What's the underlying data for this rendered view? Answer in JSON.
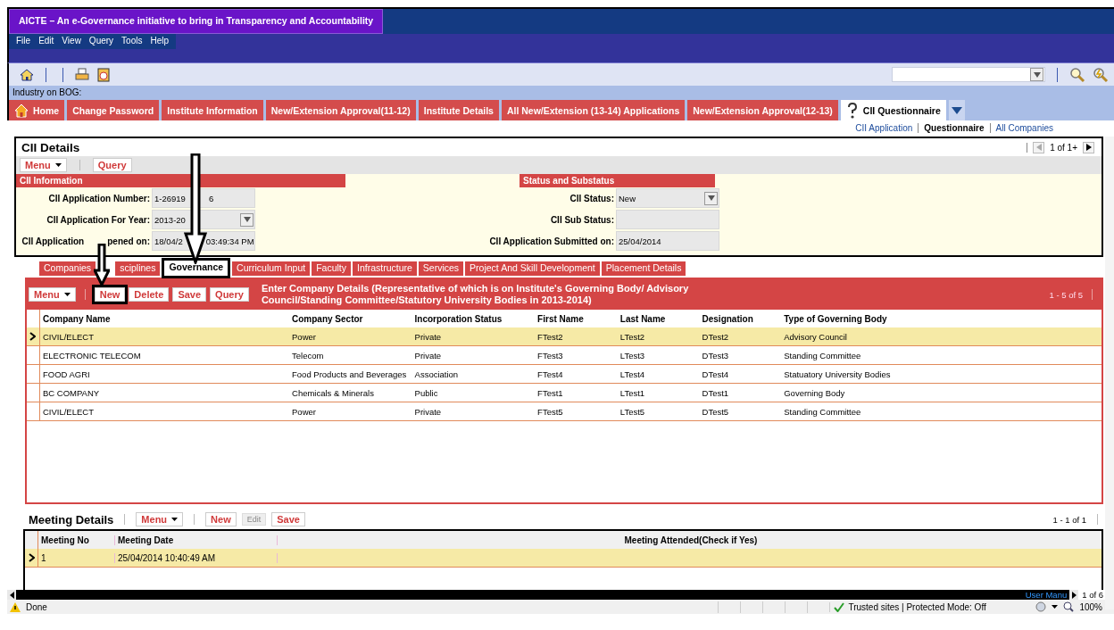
{
  "window": {
    "title": "AICTE – An e-Governance initiative to bring in Transparency and Accountability"
  },
  "menu": [
    "File",
    "Edit",
    "View",
    "Query",
    "Tools",
    "Help"
  ],
  "breadcrumb": "Industry on BOG:",
  "screen_tabs": [
    {
      "label": "Home",
      "selected": false,
      "kind": "home"
    },
    {
      "label": "Change Password",
      "selected": false,
      "kind": "plain"
    },
    {
      "label": "Institute Information",
      "selected": false,
      "kind": "plain"
    },
    {
      "label": "New/Extension Approval(11-12)",
      "selected": false,
      "kind": "plain"
    },
    {
      "label": "Institute Details",
      "selected": false,
      "kind": "plain"
    },
    {
      "label": "All New/Extension (13-14) Applications",
      "selected": false,
      "kind": "plain"
    },
    {
      "label": "New/Extension Approval(12-13)",
      "selected": false,
      "kind": "plain"
    },
    {
      "label": "CII Questionnaire",
      "selected": true,
      "kind": "icon"
    }
  ],
  "view_links": [
    {
      "label": "CII Application",
      "selected": false
    },
    {
      "label": "Questionnaire",
      "selected": true
    },
    {
      "label": "All Companies",
      "selected": false
    }
  ],
  "details": {
    "title": "CII Details",
    "pager": "1 of 1+",
    "buttons": [
      "Menu",
      "Query"
    ],
    "left_header": "CII Information",
    "right_header": "Status and Substatus",
    "left_fields": [
      {
        "label": "CII Application Number:",
        "value": "1-26919",
        "value_end": "6",
        "kind": "text"
      },
      {
        "label": "CII Application For Year:",
        "value": "2013-20",
        "kind": "dropdown"
      },
      {
        "label": "CII Application",
        "label_end": "pened on:",
        "value": "18/04/2",
        "value_end": "03:49:34 PM",
        "kind": "text"
      }
    ],
    "right_fields": [
      {
        "label": "CII Status:",
        "value": "New",
        "kind": "dropdown"
      },
      {
        "label": "CII Sub Status:",
        "kind": "text"
      },
      {
        "label": "CII Application Submitted on:",
        "value": "25/04/2014",
        "kind": "text"
      }
    ]
  },
  "view_tabs": [
    {
      "label": "Companies",
      "selected": false
    },
    {
      "label": "sciplines",
      "selected": false
    },
    {
      "label": "Governance",
      "selected": true
    },
    {
      "label": "Curriculum Input",
      "selected": false
    },
    {
      "label": "Faculty",
      "selected": false
    },
    {
      "label": "Infrastructure",
      "selected": false
    },
    {
      "label": "Services",
      "selected": false
    },
    {
      "label": "Project And Skill Development",
      "selected": false
    },
    {
      "label": "Placement Details",
      "selected": false
    }
  ],
  "companies": {
    "buttons": [
      "Menu",
      "New",
      "Delete",
      "Save",
      "Query"
    ],
    "title": "Enter Company Details (Representative of which is on Institute's Governing Body/ Advisory Council/Standing Committee/Statutory University Bodies in 2013-2014)",
    "pager": "1 - 5 of 5",
    "columns": [
      "Company Name",
      "Company Sector",
      "Incorporation Status",
      "First Name",
      "Last Name",
      "Designation",
      "Type of Governing Body"
    ],
    "rows": [
      {
        "selected": true,
        "cells": [
          "CIVIL/ELECT",
          "Power",
          "Private",
          "FTest2",
          "LTest2",
          "DTest2",
          "Advisory Council"
        ]
      },
      {
        "selected": false,
        "cells": [
          "ELECTRONIC TELECOM",
          "Telecom",
          "Private",
          "FTest3",
          "LTest3",
          "DTest3",
          "Standing Committee"
        ]
      },
      {
        "selected": false,
        "cells": [
          "FOOD AGRI",
          "Food Products and Beverages",
          "Association",
          "FTest4",
          "LTest4",
          "DTest4",
          "Statuatory University Bodies"
        ]
      },
      {
        "selected": false,
        "cells": [
          "BC COMPANY",
          "Chemicals & Minerals",
          "Public",
          "FTest1",
          "LTest1",
          "DTest1",
          "Governing Body"
        ]
      },
      {
        "selected": false,
        "cells": [
          "CIVIL/ELECT",
          "Power",
          "Private",
          "FTest5",
          "LTest5",
          "DTest5",
          "Standing Committee"
        ]
      }
    ]
  },
  "meetings": {
    "title": "Meeting Details",
    "buttons": [
      {
        "label": "Menu",
        "disabled": false
      },
      {
        "label": "New",
        "disabled": false
      },
      {
        "label": "Edit",
        "disabled": true
      },
      {
        "label": "Save",
        "disabled": false
      }
    ],
    "pager": "1 - 1 of 1",
    "columns": [
      "Meeting No",
      "Meeting Date",
      "Meeting Attended(Check if Yes)"
    ],
    "rows": [
      {
        "selected": true,
        "cells": [
          "1",
          "25/04/2014 10:40:49 AM"
        ]
      }
    ]
  },
  "footer": {
    "link": "User Manu",
    "pager": "1 of 6"
  },
  "status_bar": {
    "text": "Done",
    "zone": "Trusted sites | Protected Mode: Off",
    "zoom": "100%"
  }
}
